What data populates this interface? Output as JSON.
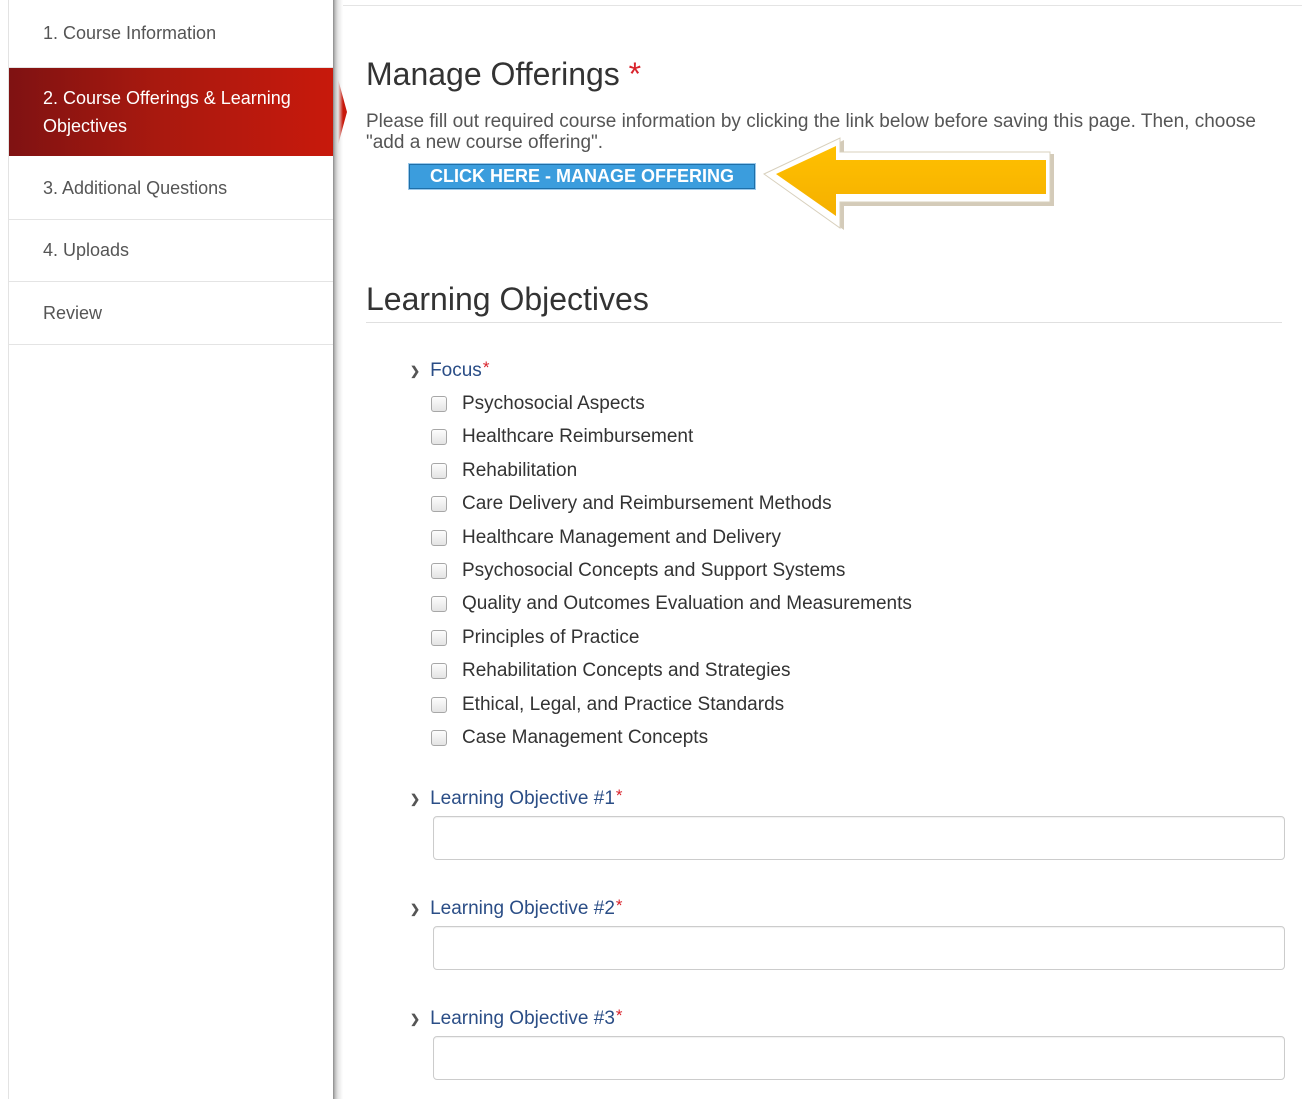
{
  "sidebar": {
    "items": [
      {
        "label": "1. Course Information"
      },
      {
        "label": "2. Course Offerings & Learning Objectives"
      },
      {
        "label": "3. Additional Questions"
      },
      {
        "label": "4. Uploads"
      },
      {
        "label": "Review"
      }
    ],
    "active_index": 1,
    "active_color": "#c8190c"
  },
  "manage_offerings": {
    "title": "Manage Offerings",
    "required_marker": "*",
    "instructions": "Please fill out required course information by clicking the link below before saving this page. Then, choose \"add a new course offering\".",
    "button_label": "CLICK HERE - MANAGE OFFERING",
    "arrow_color": "#ffc000"
  },
  "learning_objectives": {
    "title": "Learning Objectives",
    "focus": {
      "label": "Focus",
      "required_marker": "*",
      "options": [
        "Psychosocial Aspects",
        "Healthcare Reimbursement",
        "Rehabilitation",
        "Care Delivery and Reimbursement Methods",
        "Healthcare Management and Delivery",
        "Psychosocial Concepts and Support Systems",
        "Quality and Outcomes Evaluation and Measurements",
        "Principles of Practice",
        "Rehabilitation Concepts and Strategies",
        "Ethical, Legal, and Practice Standards",
        "Case Management Concepts"
      ]
    },
    "objectives": [
      {
        "label": "Learning Objective #1",
        "required_marker": "*",
        "value": ""
      },
      {
        "label": "Learning Objective #2",
        "required_marker": "*",
        "value": ""
      },
      {
        "label": "Learning Objective #3",
        "required_marker": "*",
        "value": ""
      }
    ]
  }
}
